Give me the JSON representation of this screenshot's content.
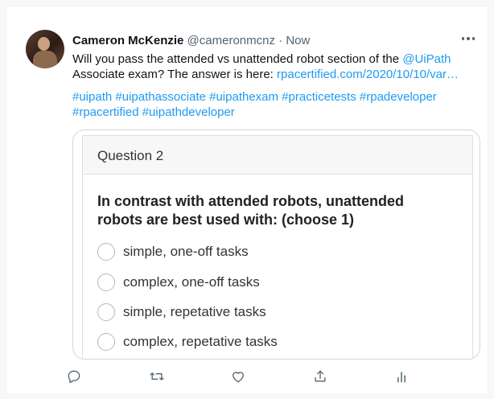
{
  "tweet": {
    "author_name": "Cameron McKenzie",
    "author_handle": "@cameronmcnz",
    "separator": "·",
    "time": "Now",
    "text_part1": "Will you pass the attended vs unattended robot section of the ",
    "mention": "@UiPath",
    "text_part2": " Associate exam? The answer is here: ",
    "url": "rpacertified.com/2020/10/10/var…",
    "hashtags_line1": "#uipath #uipathassociate #uipathexam #practicetests #rpadeveloper",
    "hashtags_line2": "#rpacertified #uipathdeveloper"
  },
  "quiz": {
    "header": "Question 2",
    "question": "In contrast with attended robots, unattended robots are best used with: (choose 1)",
    "options": [
      "simple, one-off tasks",
      "complex, one-off tasks",
      "simple, repetative tasks",
      "complex, repetative tasks"
    ]
  },
  "icons": {
    "avatar": "user-photo",
    "more": "more-horizontal-icon",
    "reply": "reply-icon",
    "retweet": "retweet-icon",
    "like": "heart-icon",
    "share": "share-icon",
    "analytics": "analytics-icon"
  },
  "colors": {
    "link": "#1d9bf0",
    "text": "#0f1419",
    "muted": "#536471",
    "border": "#cfd9de"
  }
}
